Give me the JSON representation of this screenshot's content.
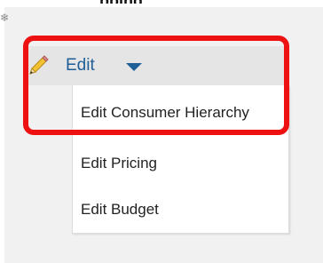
{
  "top_fragment": "pping",
  "menu": {
    "title": "Edit",
    "items": [
      {
        "label": "Edit Consumer Hierarchy"
      },
      {
        "label": "Edit Pricing"
      },
      {
        "label": "Edit Budget"
      }
    ]
  },
  "colors": {
    "accent": "#1e5f97",
    "highlight": "#ee1111",
    "header_bg": "#e5e5e5",
    "backdrop": "#f1f1f1"
  },
  "icons": {
    "pencil": "pencil-icon",
    "caret": "chevron-down-icon"
  }
}
